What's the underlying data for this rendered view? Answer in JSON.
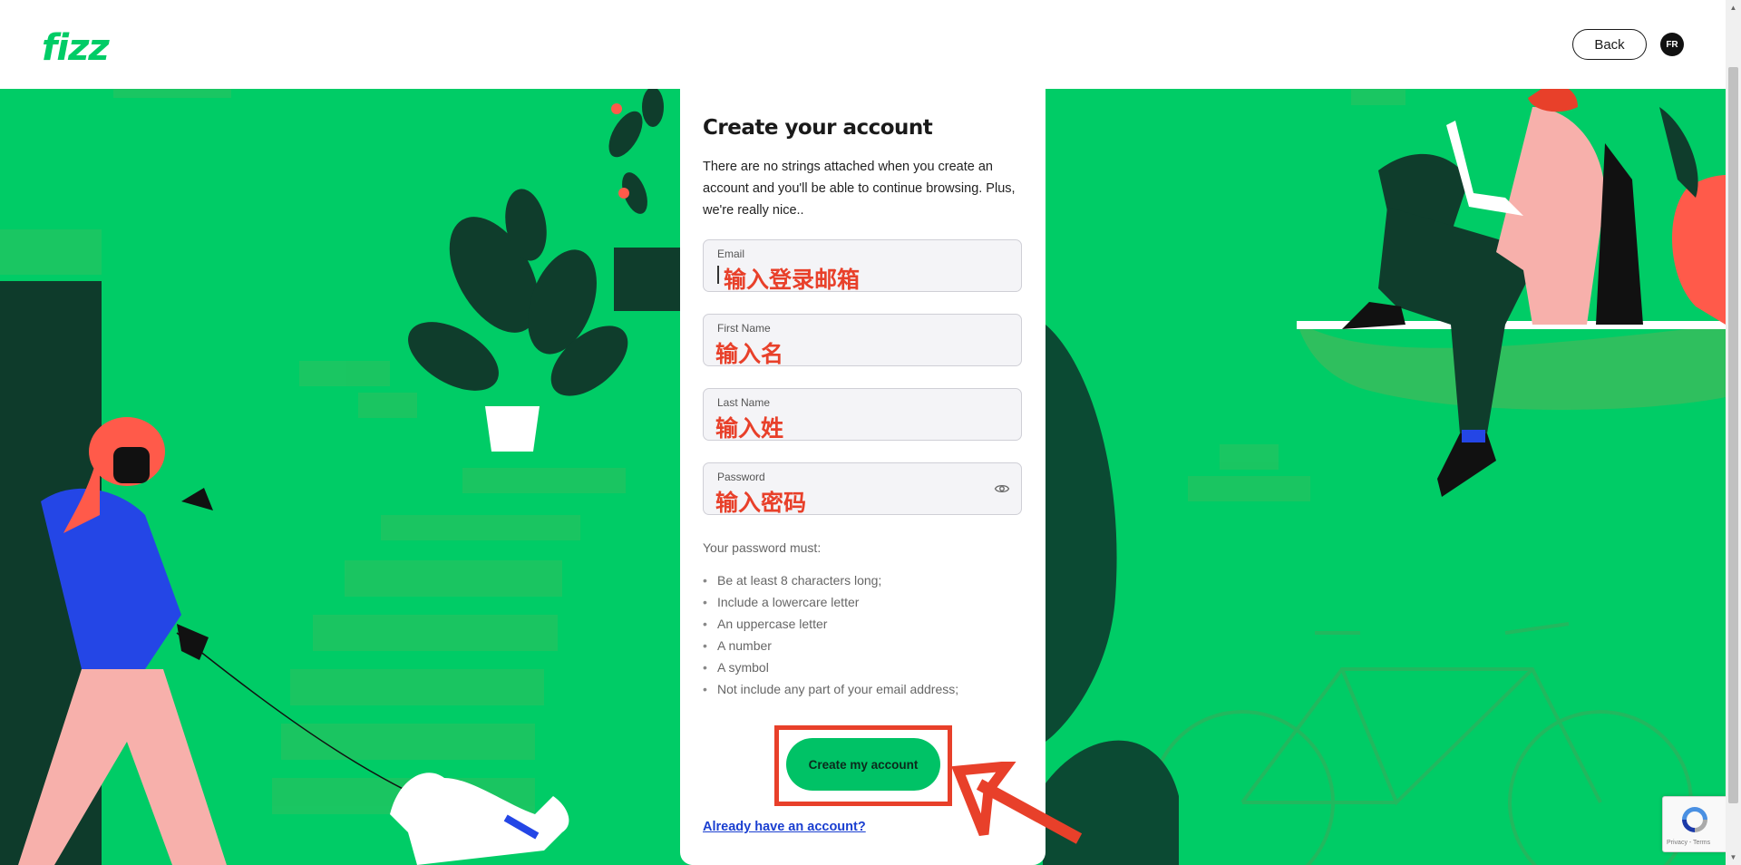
{
  "header": {
    "logo": "fizz",
    "back_label": "Back",
    "lang_label": "FR"
  },
  "form": {
    "title": "Create your account",
    "intro": "There are no strings attached when you create an account and you'll be able to continue browsing. Plus, we're really nice..",
    "fields": [
      {
        "label": "Email",
        "value": "输入登录邮箱"
      },
      {
        "label": "First Name",
        "value": "输入名"
      },
      {
        "label": "Last Name",
        "value": "输入姓"
      },
      {
        "label": "Password",
        "value": "输入密码"
      }
    ],
    "rules_title": "Your password must:",
    "rules": [
      "Be at least 8 characters long;",
      "Include a lowercare letter",
      "An uppercase letter",
      "A number",
      "A symbol",
      "Not include any part of your email address;"
    ],
    "submit_label": "Create my account",
    "login_link": "Already have an account?"
  },
  "recaptcha": {
    "text": "Privacy - Terms"
  },
  "colors": {
    "brand_green": "#00cc66",
    "annotation_red": "#e8402a",
    "link_blue": "#1a3fd0"
  }
}
